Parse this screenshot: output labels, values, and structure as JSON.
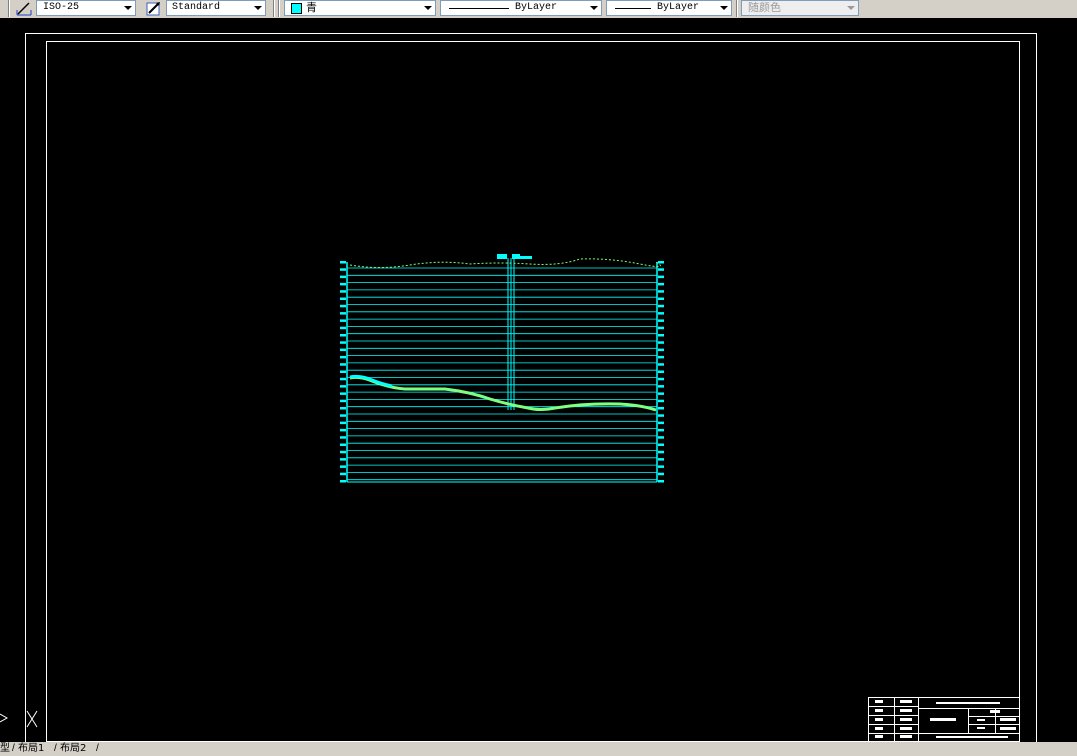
{
  "toolbar": {
    "dimstyle_value": "ISO-25",
    "textstyle_value": "Standard",
    "color_value": "青",
    "color_hex": "#00ffff",
    "linetype_value": "ByLayer",
    "lineweight_value": "ByLayer",
    "plotstyle_value": "随颜色"
  },
  "tabs": {
    "model_label": "型",
    "layout1_label": "布局1",
    "layout2_label": "布局2"
  },
  "colors": {
    "canvas": "#000000",
    "border": "#ffffff",
    "section": "#00ffff",
    "ground_line": "#7fff7f",
    "toolbar_bg": "#d4d0c8"
  }
}
